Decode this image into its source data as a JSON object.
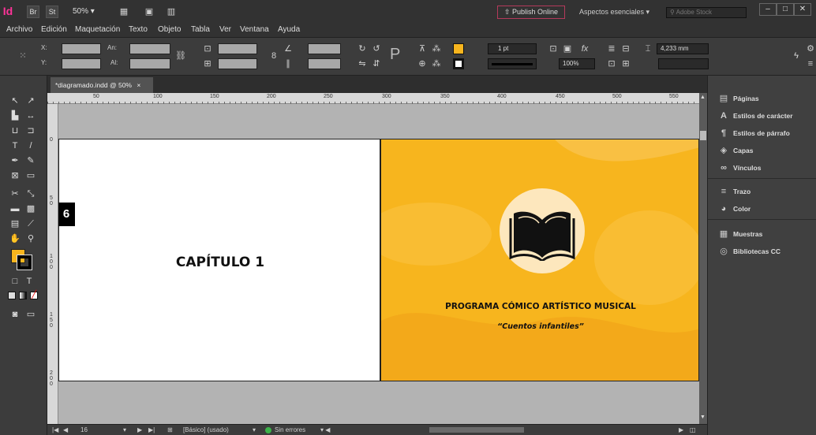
{
  "app": {
    "logo": "Id",
    "bridge": "Br",
    "stock": "St",
    "zoom": "50%",
    "publish_online": "Publish Online",
    "workspace": "Aspectos esenciales",
    "search_placeholder": "Adobe Stock"
  },
  "menu": [
    "Archivo",
    "Edición",
    "Maquetación",
    "Texto",
    "Objeto",
    "Tabla",
    "Ver",
    "Ventana",
    "Ayuda"
  ],
  "control": {
    "x_label": "X:",
    "y_label": "Y:",
    "w_label": "An:",
    "h_label": "Al:",
    "stroke_weight": "1 pt",
    "opacity": "100%",
    "dimension": "4,233 mm"
  },
  "document_tab": {
    "title": "*diagramado.indd @ 50%",
    "close": "×"
  },
  "ruler_h": [
    "50",
    "100",
    "150",
    "200",
    "250",
    "300",
    "350",
    "400",
    "450",
    "500",
    "550"
  ],
  "ruler_v_zero": "0",
  "ruler_v": [
    "50",
    "100",
    "150",
    "200"
  ],
  "page": {
    "number": "6",
    "chapter": "CAPÍTULO 1",
    "program_title": "PROGRAMA CÓMICO ARTÍSTICO MUSICAL",
    "subtitle": "“Cuentos infantiles”"
  },
  "panels": [
    {
      "icon": "pages-icon",
      "glyph": "▤",
      "label": "Páginas"
    },
    {
      "icon": "character-styles-icon",
      "glyph": "A",
      "label": "Estilos de carácter"
    },
    {
      "icon": "paragraph-styles-icon",
      "glyph": "¶",
      "label": "Estilos de párrafo"
    },
    {
      "icon": "layers-icon",
      "glyph": "◈",
      "label": "Capas"
    },
    {
      "icon": "links-icon",
      "glyph": "∞",
      "label": "Vínculos"
    },
    {
      "icon": "stroke-icon",
      "glyph": "≡",
      "label": "Trazo"
    },
    {
      "icon": "color-icon",
      "glyph": "◕",
      "label": "Color"
    },
    {
      "icon": "swatches-icon",
      "glyph": "▦",
      "label": "Muestras"
    },
    {
      "icon": "cc-libraries-icon",
      "glyph": "◎",
      "label": "Bibliotecas CC"
    }
  ],
  "status": {
    "page": "16",
    "style": "[Básico] (usado)",
    "preflight": "Sin errores"
  },
  "colors": {
    "accent_yellow": "#f7b51e",
    "circle": "#fde7bd",
    "preflight_ok": "#3cb34a"
  }
}
